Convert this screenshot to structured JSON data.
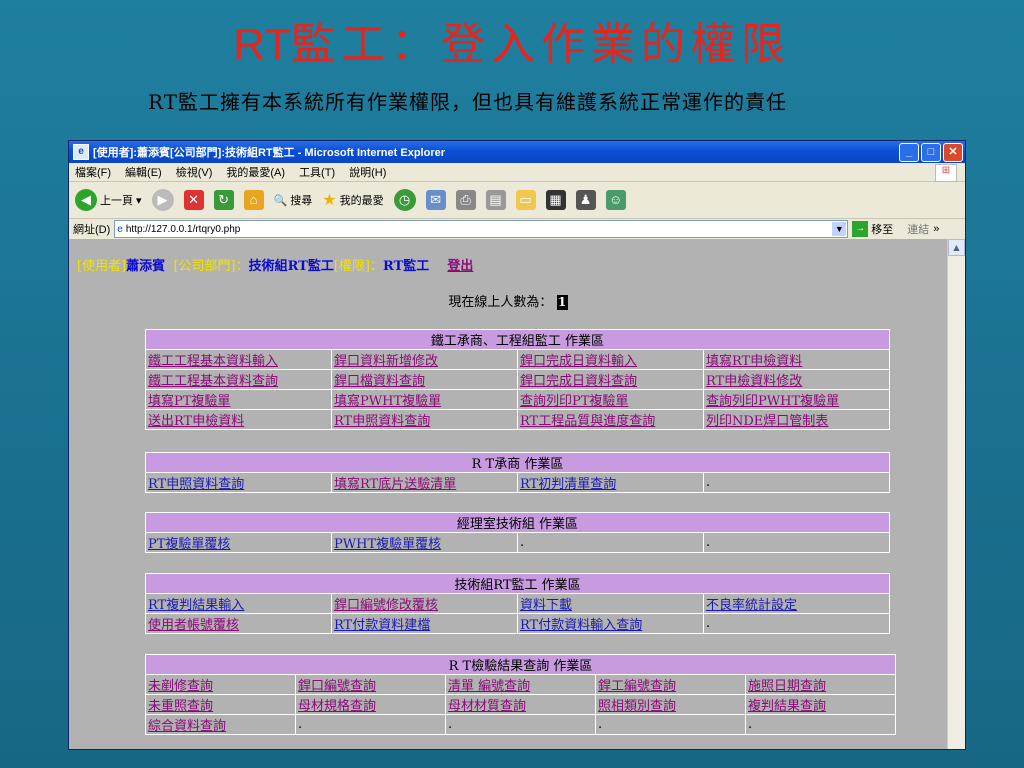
{
  "slide": {
    "title_rt": "RT",
    "title_rest": "監工：登入作業的權限",
    "subtitle": "RT監工擁有本系統所有作業權限，但也具有維護系統正常運作的責任"
  },
  "window": {
    "title": "[使用者]:蕭添賓[公司部門]:技術組RT監工 - Microsoft Internet Explorer",
    "buttons": {
      "min": "_",
      "max": "□",
      "close": "✕"
    }
  },
  "menu": [
    "檔案(F)",
    "編輯(E)",
    "檢視(V)",
    "我的最愛(A)",
    "工具(T)",
    "說明(H)"
  ],
  "toolbar": {
    "back": "上一頁",
    "search": "搜尋",
    "favorites": "我的最愛"
  },
  "address": {
    "label": "網址(D)",
    "url": "http://127.0.0.1/rtqry0.php",
    "go": "移至",
    "links": "連結"
  },
  "user": {
    "user_label": "[使用者]",
    "user_name": "蕭添賓",
    "dept_label": "[公司部門]：",
    "dept_name": "技術組RT監工",
    "perm_label": "[權限]：",
    "perm_name": "RT監工",
    "logout": "登出"
  },
  "online": {
    "label": "現在線上人數為：",
    "count": "1"
  },
  "areas": [
    {
      "title": "鐵工承商、工程組監工 作業區",
      "cols": 4,
      "rows": [
        [
          "鐵工工程基本資料輸入",
          "銲口資料新增修改",
          "銲口完成日資料輸入",
          "填寫RT申檢資料"
        ],
        [
          "鐵工工程基本資料查詢",
          "銲口檔資料查詢",
          "銲口完成日資料查詢",
          "RT申檢資料修改"
        ],
        [
          "填寫PT複驗單",
          "填寫PWHT複驗單",
          "查詢列印PT複驗單",
          "查詢列印PWHT複驗單"
        ],
        [
          "送出RT申檢資料",
          "RT申照資料查詢",
          "RT工程品質與進度查詢",
          "列印NDE焊口管制表"
        ]
      ]
    },
    {
      "title": "R T承商 作業區",
      "cols": 4,
      "rows": [
        [
          "RT申照資料查詢",
          "填寫RT底片送驗清單",
          "RT初判清單查詢",
          "."
        ]
      ]
    },
    {
      "title": "經理室技術組 作業區",
      "cols": 4,
      "rows": [
        [
          "PT複驗單覆核",
          "PWHT複驗單覆核",
          ".",
          "."
        ]
      ]
    },
    {
      "title": "技術組RT監工 作業區",
      "cols": 4,
      "rows": [
        [
          "RT複判結果輸入",
          "銲口編號修改覆核",
          "資料下載",
          "不良率統計設定"
        ],
        [
          "使用者帳號覆核",
          "RT付款資料建檔",
          "RT付款資料輸入查詢",
          "."
        ]
      ]
    },
    {
      "title": "R T檢驗結果查詢 作業區",
      "cols": 5,
      "rows": [
        [
          "未剷修查詢",
          "銲口編號查詢",
          "清單 編號查詢",
          "銲工編號查詢",
          "施照日期查詢"
        ],
        [
          "未重照查詢",
          "母材規格查詢",
          "母材材質查詢",
          "照相類別查詢",
          "複判結果查詢"
        ],
        [
          "綜合資料查詢",
          ".",
          ".",
          ".",
          "."
        ]
      ]
    }
  ]
}
